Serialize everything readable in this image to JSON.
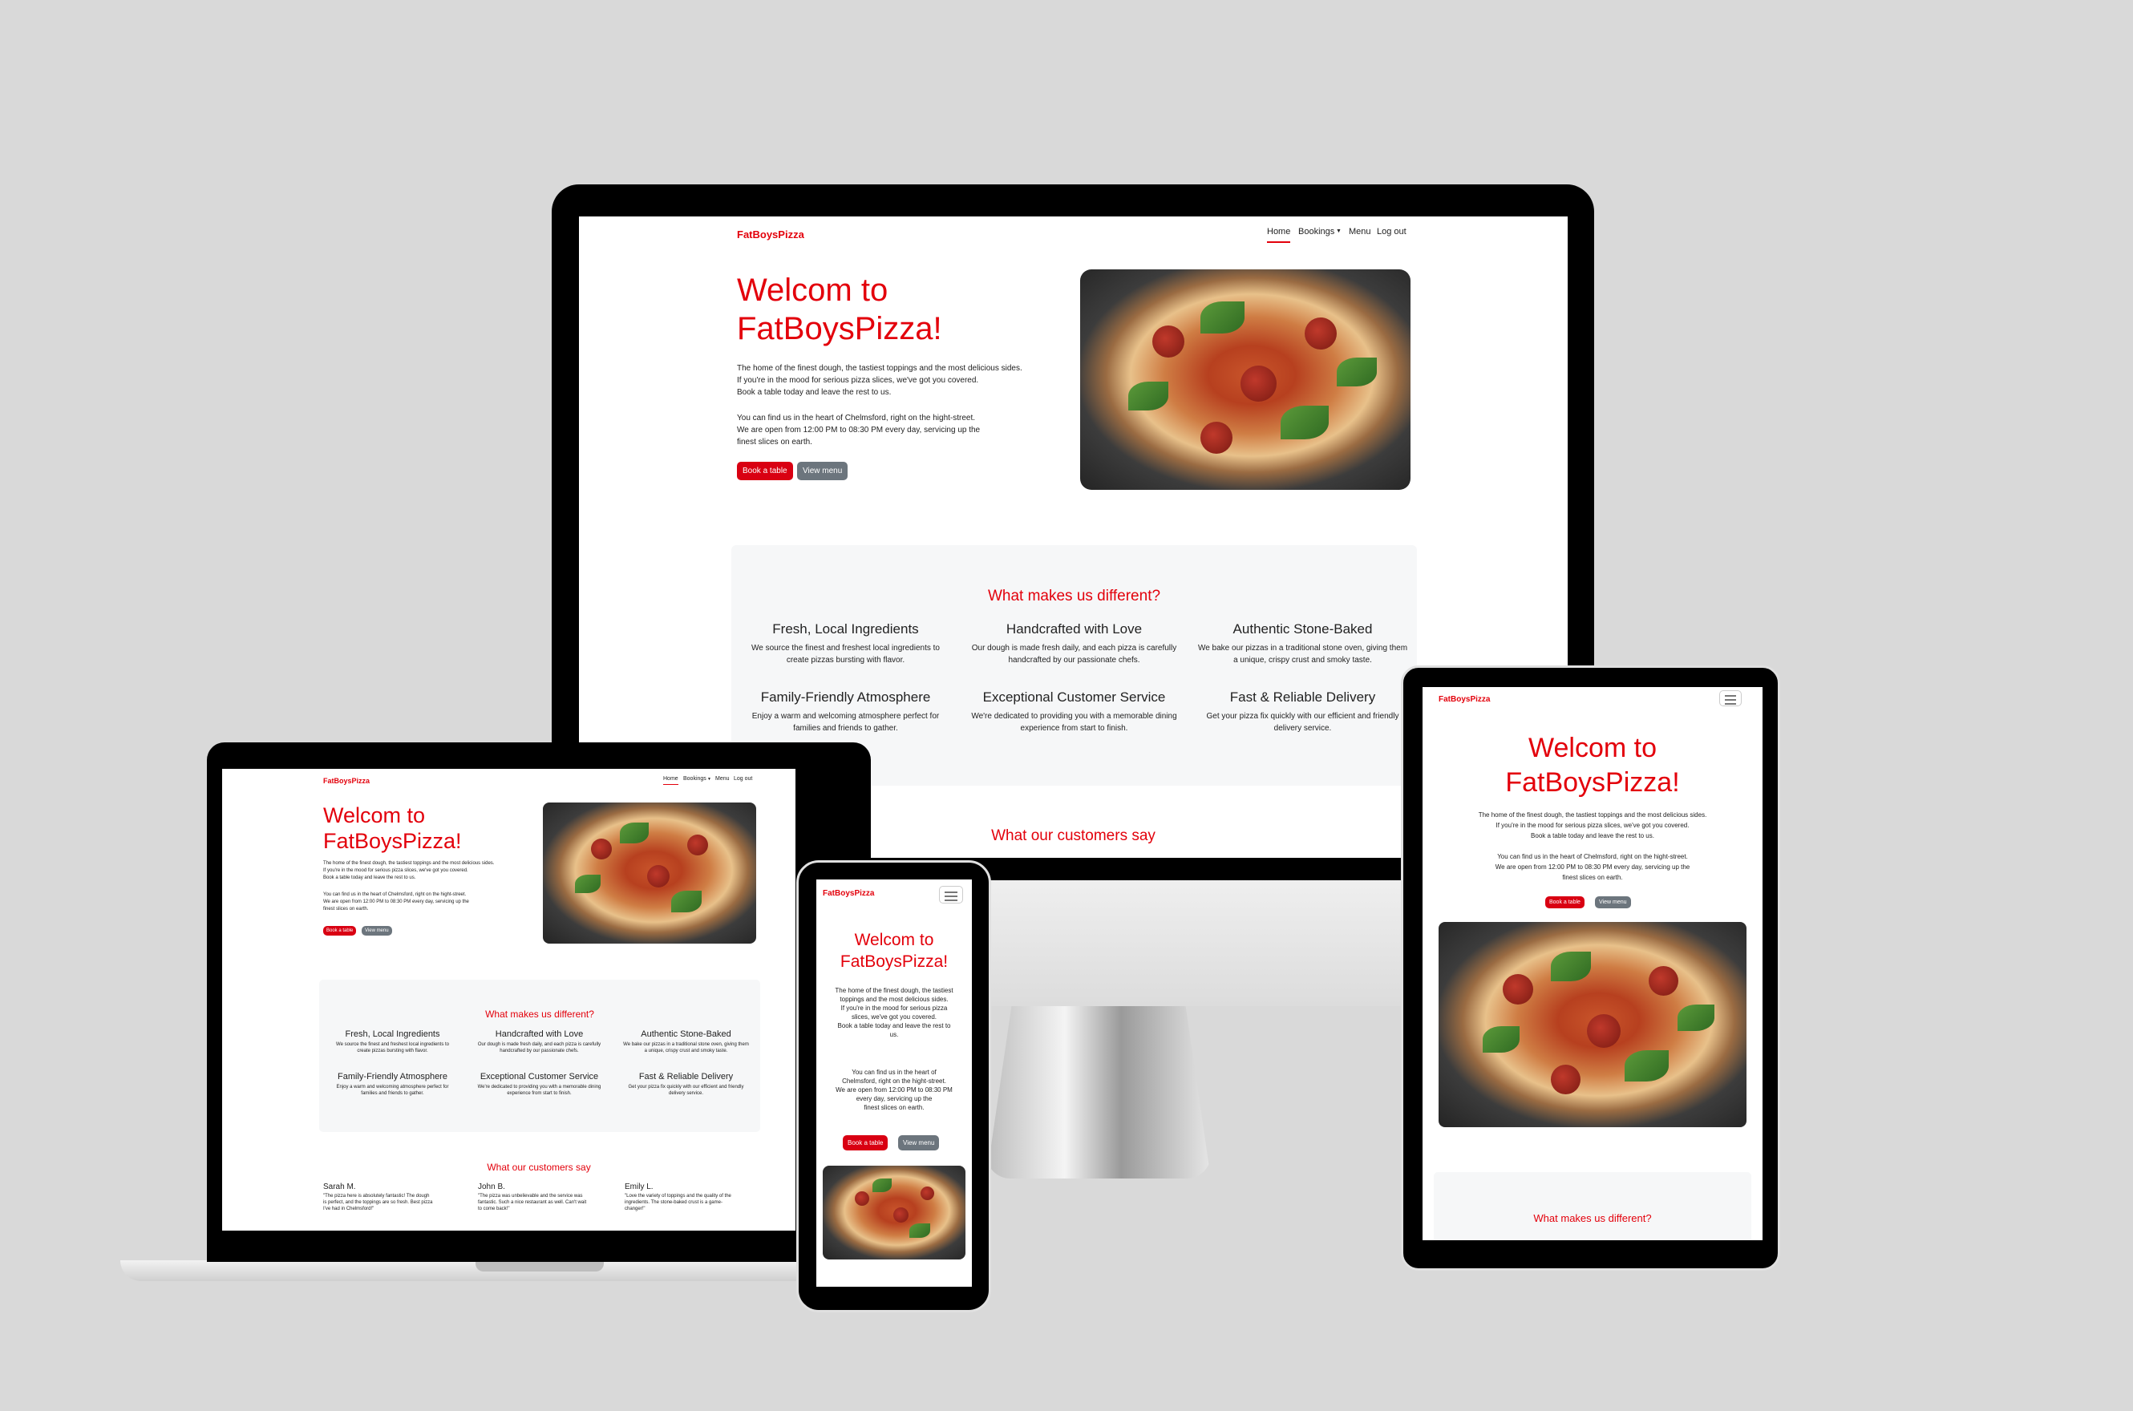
{
  "site": {
    "brand": "FatBoysPizza",
    "nav": [
      "Home",
      "Bookings",
      "Menu",
      "Log out"
    ],
    "hero_title_1": "Welcom to",
    "hero_title_2": "FatBoysPizza!",
    "intro_1": "The home of the finest dough, the tastiest toppings and the most delicious sides.",
    "intro_2": "If you're in the mood for serious pizza slices, we've got you covered.",
    "intro_3": "Book a table today and leave the rest to us.",
    "loc_1": "You can find us in the heart of Chelmsford, right on the hight-street.",
    "loc_2": "We are open from 12:00 PM to 08:30 PM every day, servicing up the",
    "loc_3": "finest slices on earth.",
    "book_btn": "Book a table",
    "menu_btn": "View menu",
    "features_title": "What makes us different?",
    "features": [
      {
        "title": "Fresh, Local Ingredients",
        "l1": "We source the finest and freshest local ingredients to",
        "l2": "create pizzas bursting with flavor."
      },
      {
        "title": "Handcrafted with Love",
        "l1": "Our dough is made fresh daily, and each pizza is carefully",
        "l2": "handcrafted by our passionate chefs."
      },
      {
        "title": "Authentic Stone-Baked",
        "l1": "We bake our pizzas in a traditional stone oven, giving them",
        "l2": "a unique, crispy crust and smoky taste."
      },
      {
        "title": "Family-Friendly Atmosphere",
        "l1": "Enjoy a warm and welcoming atmosphere perfect for",
        "l2": "families and friends to gather."
      },
      {
        "title": "Exceptional Customer Service",
        "l1": "We're dedicated to providing you with a memorable dining",
        "l2": "experience from start to finish."
      },
      {
        "title": "Fast & Reliable Delivery",
        "l1": "Get your pizza fix quickly with our efficient and friendly",
        "l2": "delivery service."
      }
    ],
    "reviews_title": "What our customers say",
    "reviews": [
      {
        "name": "Sarah M.",
        "l1": "\"The pizza here is absolutely fantastic! The dough",
        "l2": "is perfect, and the toppings are so fresh. Best pizza",
        "l3": "I've had in Chelmsford!\""
      },
      {
        "name": "John B.",
        "l1": "\"The pizza was unbelievable and the service was",
        "l2": "fantastic. Such a nice restaurant as well. Can't wait",
        "l3": "to come back!\""
      },
      {
        "name": "Emily L.",
        "l1": "\"Love the variety of toppings and the quality of the",
        "l2": "ingredients. The stone-baked crust is a game-",
        "l3": "changer!\""
      }
    ],
    "mobile_intro": [
      "The home of the finest dough, the tastiest",
      "toppings and the most delicious sides.",
      "If you're in the mood for serious pizza",
      "slices, we've got you covered.",
      "Book a table today and leave the rest to",
      "us."
    ],
    "mobile_loc": [
      "You can find us in the heart of",
      "Chelmsford, right on the hight-street.",
      "We are open from 12:00 PM to 08:30 PM",
      "every day, servicing up the",
      "finest slices on earth."
    ],
    "tablet_intro": [
      "The home of the finest dough, the tastiest toppings and the most delicious sides.",
      "If you're in the mood for serious pizza slices, we've got you covered.",
      "Book a table today and leave the rest to us."
    ],
    "tablet_loc": [
      "You can find us in the heart of Chelmsford, right on the hight-street.",
      "We are open from 12:00 PM to 08:30 PM every day, servicing up the",
      "finest slices on earth."
    ]
  },
  "colors": {
    "brand_red": "#e3000b",
    "button_red": "#d90012",
    "button_grey": "#6c757d",
    "background": "#d9d9d9"
  },
  "icons": [
    "hamburger-menu-icon",
    "caret-down-icon"
  ]
}
